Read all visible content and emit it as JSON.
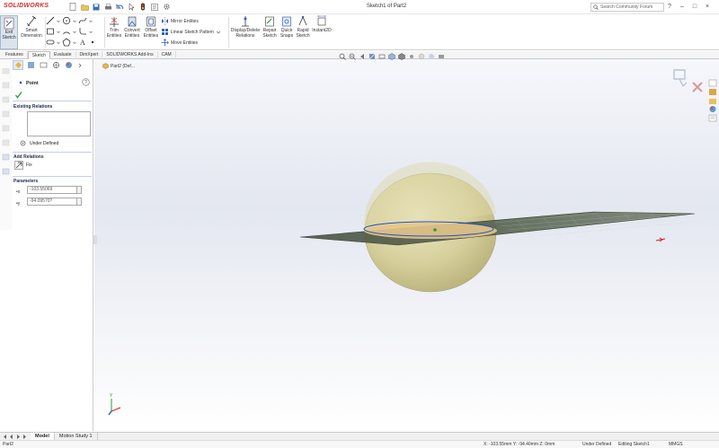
{
  "app": {
    "name": "SOLIDWORKS",
    "window_title": "Sketch1 of Part2"
  },
  "search": {
    "placeholder": "Search Community Forum"
  },
  "ribbon": {
    "exit_sketch": "Exit Sketch",
    "smart_dimension": "Smart Dimension",
    "trim_entities": "Trim Entities",
    "convert_entities": "Convert Entities",
    "offset_entities": "Offset Entities",
    "mirror_entities": "Mirror Entities",
    "linear_pattern": "Linear Sketch Pattern",
    "move_entities": "Move Entities",
    "display_relations": "Display/Delete Relations",
    "repair_sketch": "Repair Sketch",
    "quick_snaps": "Quick Snaps",
    "rapid_sketch": "Rapid Sketch",
    "instant2d": "Instant2D"
  },
  "cm_tabs": [
    "Features",
    "Sketch",
    "Evaluate",
    "DimXpert",
    "SOLIDWORKS Add-Ins",
    "CAM"
  ],
  "cm_active": "Sketch",
  "tree_flyout": "Part2 (Def...",
  "panel": {
    "title": "Point",
    "existing_relations_title": "Existing Relations",
    "status": "Under Defined",
    "add_relations_title": "Add Relations",
    "fix_label": "Fix",
    "parameters_title": "Parameters",
    "param_x": "-103.55069",
    "param_y": "-94.09570?"
  },
  "bottom_tabs": [
    "Model",
    "Motion Study 1"
  ],
  "bottom_active": "Model",
  "status": {
    "part": "Part2",
    "coords": "X: -103.55mm Y: -94.40mm Z: 0mm",
    "defined": "Under Defined",
    "editing": "Editing Sketch1",
    "units": "MMGS"
  },
  "colors": {
    "brand_red": "#d7282f",
    "sketch_blue": "#1f4fc8",
    "check_green": "#2f9a3a"
  }
}
